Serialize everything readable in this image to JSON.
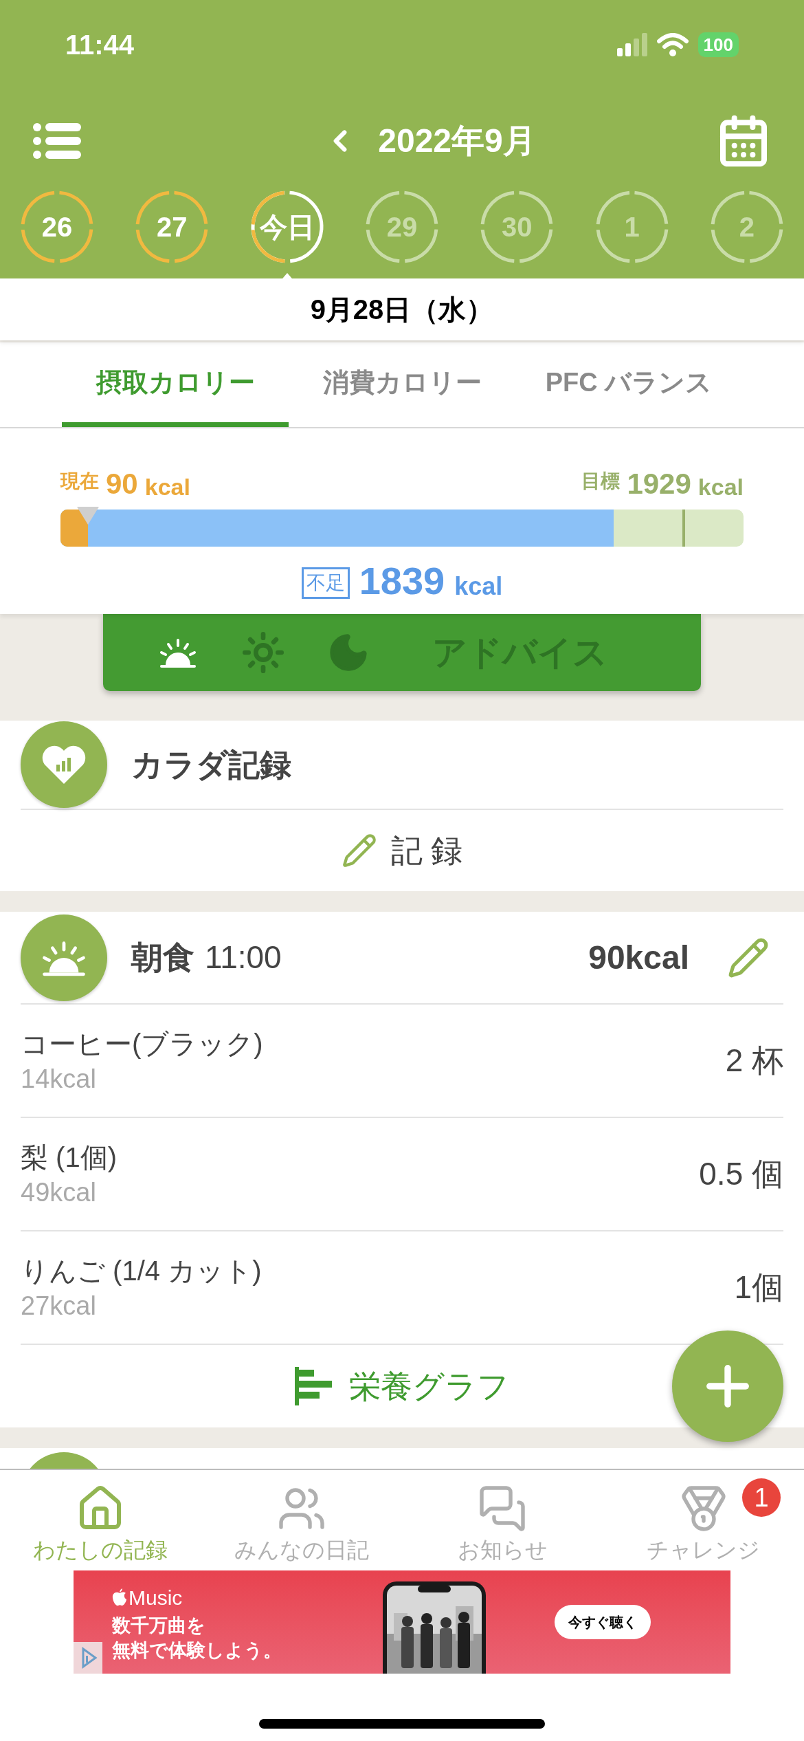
{
  "status_bar": {
    "time": "11:44",
    "battery": "100"
  },
  "header": {
    "month": "2022年9月"
  },
  "days": [
    {
      "label": "26",
      "kind": "past"
    },
    {
      "label": "27",
      "kind": "past"
    },
    {
      "label": "今日",
      "kind": "today"
    },
    {
      "label": "29",
      "kind": "future"
    },
    {
      "label": "30",
      "kind": "future"
    },
    {
      "label": "1",
      "kind": "future"
    },
    {
      "label": "2",
      "kind": "future"
    }
  ],
  "date": "9月28日（水）",
  "tabs": [
    {
      "label": "摂取カロリー",
      "selected": true
    },
    {
      "label": "消費カロリー",
      "selected": false
    },
    {
      "label": "PFC バランス",
      "selected": false
    }
  ],
  "calories": {
    "current_label": "現在",
    "current_value": "90",
    "current_unit": "kcal",
    "target_label": "目標",
    "target_value": "1929",
    "target_unit": "kcal",
    "intake": {
      "level": 0.04
    },
    "shortfall": {
      "level": 0.81
    },
    "target_marker": {
      "level": 0.91
    },
    "shortfall_label": "不足",
    "shortfall_value": "1839",
    "shortfall_unit": "kcal"
  },
  "advice": {
    "label": "アドバイス",
    "meals": [
      {
        "kind": "morning",
        "active": true
      },
      {
        "kind": "noon",
        "active": false
      },
      {
        "kind": "night",
        "active": false
      }
    ]
  },
  "body_record": {
    "title": "カラダ記録",
    "action": "記 録"
  },
  "meal": {
    "kind": "morning",
    "title": "朝食",
    "time": "11:00",
    "total": "90kcal",
    "items": [
      {
        "name": "コーヒー(ブラック)",
        "kcal": "14kcal",
        "amount": "2 杯"
      },
      {
        "name": "梨 (1個)",
        "kcal": "49kcal",
        "amount": "0.5 個"
      },
      {
        "name": "りんご (1/4 カット)",
        "kcal": "27kcal",
        "amount": "1個"
      }
    ],
    "graph_link": "栄養グラフ"
  },
  "bottom_nav": [
    {
      "kind": "home",
      "label": "わたしの記録",
      "selected": true
    },
    {
      "kind": "people",
      "label": "みんなの日記",
      "selected": false
    },
    {
      "kind": "news",
      "label": "お知らせ",
      "selected": false
    },
    {
      "kind": "challenge",
      "label": "チャレンジ",
      "selected": false,
      "badge": "1"
    }
  ],
  "ad": {
    "brand": "Music",
    "headline": [
      "数千万曲を",
      "無料で体験しよう。"
    ],
    "cta": "今すぐ聴く"
  }
}
